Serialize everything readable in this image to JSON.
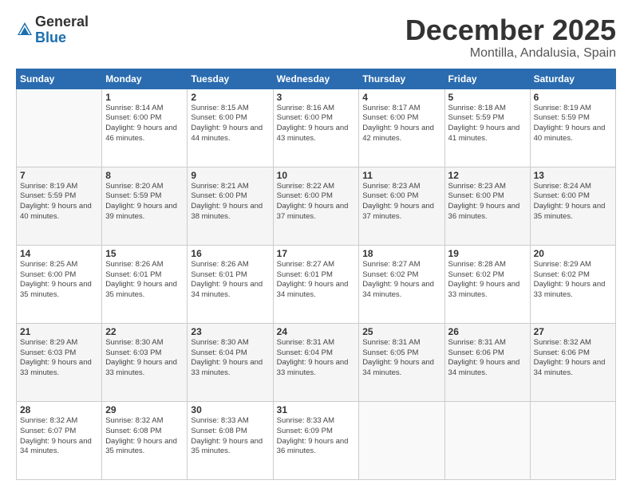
{
  "logo": {
    "general": "General",
    "blue": "Blue"
  },
  "header": {
    "month": "December 2025",
    "location": "Montilla, Andalusia, Spain"
  },
  "weekdays": [
    "Sunday",
    "Monday",
    "Tuesday",
    "Wednesday",
    "Thursday",
    "Friday",
    "Saturday"
  ],
  "weeks": [
    [
      {
        "day": "",
        "sunrise": "",
        "sunset": "",
        "daylight": ""
      },
      {
        "day": "1",
        "sunrise": "Sunrise: 8:14 AM",
        "sunset": "Sunset: 6:00 PM",
        "daylight": "Daylight: 9 hours and 46 minutes."
      },
      {
        "day": "2",
        "sunrise": "Sunrise: 8:15 AM",
        "sunset": "Sunset: 6:00 PM",
        "daylight": "Daylight: 9 hours and 44 minutes."
      },
      {
        "day": "3",
        "sunrise": "Sunrise: 8:16 AM",
        "sunset": "Sunset: 6:00 PM",
        "daylight": "Daylight: 9 hours and 43 minutes."
      },
      {
        "day": "4",
        "sunrise": "Sunrise: 8:17 AM",
        "sunset": "Sunset: 6:00 PM",
        "daylight": "Daylight: 9 hours and 42 minutes."
      },
      {
        "day": "5",
        "sunrise": "Sunrise: 8:18 AM",
        "sunset": "Sunset: 5:59 PM",
        "daylight": "Daylight: 9 hours and 41 minutes."
      },
      {
        "day": "6",
        "sunrise": "Sunrise: 8:19 AM",
        "sunset": "Sunset: 5:59 PM",
        "daylight": "Daylight: 9 hours and 40 minutes."
      }
    ],
    [
      {
        "day": "7",
        "sunrise": "Sunrise: 8:19 AM",
        "sunset": "Sunset: 5:59 PM",
        "daylight": "Daylight: 9 hours and 40 minutes."
      },
      {
        "day": "8",
        "sunrise": "Sunrise: 8:20 AM",
        "sunset": "Sunset: 5:59 PM",
        "daylight": "Daylight: 9 hours and 39 minutes."
      },
      {
        "day": "9",
        "sunrise": "Sunrise: 8:21 AM",
        "sunset": "Sunset: 6:00 PM",
        "daylight": "Daylight: 9 hours and 38 minutes."
      },
      {
        "day": "10",
        "sunrise": "Sunrise: 8:22 AM",
        "sunset": "Sunset: 6:00 PM",
        "daylight": "Daylight: 9 hours and 37 minutes."
      },
      {
        "day": "11",
        "sunrise": "Sunrise: 8:23 AM",
        "sunset": "Sunset: 6:00 PM",
        "daylight": "Daylight: 9 hours and 37 minutes."
      },
      {
        "day": "12",
        "sunrise": "Sunrise: 8:23 AM",
        "sunset": "Sunset: 6:00 PM",
        "daylight": "Daylight: 9 hours and 36 minutes."
      },
      {
        "day": "13",
        "sunrise": "Sunrise: 8:24 AM",
        "sunset": "Sunset: 6:00 PM",
        "daylight": "Daylight: 9 hours and 35 minutes."
      }
    ],
    [
      {
        "day": "14",
        "sunrise": "Sunrise: 8:25 AM",
        "sunset": "Sunset: 6:00 PM",
        "daylight": "Daylight: 9 hours and 35 minutes."
      },
      {
        "day": "15",
        "sunrise": "Sunrise: 8:26 AM",
        "sunset": "Sunset: 6:01 PM",
        "daylight": "Daylight: 9 hours and 35 minutes."
      },
      {
        "day": "16",
        "sunrise": "Sunrise: 8:26 AM",
        "sunset": "Sunset: 6:01 PM",
        "daylight": "Daylight: 9 hours and 34 minutes."
      },
      {
        "day": "17",
        "sunrise": "Sunrise: 8:27 AM",
        "sunset": "Sunset: 6:01 PM",
        "daylight": "Daylight: 9 hours and 34 minutes."
      },
      {
        "day": "18",
        "sunrise": "Sunrise: 8:27 AM",
        "sunset": "Sunset: 6:02 PM",
        "daylight": "Daylight: 9 hours and 34 minutes."
      },
      {
        "day": "19",
        "sunrise": "Sunrise: 8:28 AM",
        "sunset": "Sunset: 6:02 PM",
        "daylight": "Daylight: 9 hours and 33 minutes."
      },
      {
        "day": "20",
        "sunrise": "Sunrise: 8:29 AM",
        "sunset": "Sunset: 6:02 PM",
        "daylight": "Daylight: 9 hours and 33 minutes."
      }
    ],
    [
      {
        "day": "21",
        "sunrise": "Sunrise: 8:29 AM",
        "sunset": "Sunset: 6:03 PM",
        "daylight": "Daylight: 9 hours and 33 minutes."
      },
      {
        "day": "22",
        "sunrise": "Sunrise: 8:30 AM",
        "sunset": "Sunset: 6:03 PM",
        "daylight": "Daylight: 9 hours and 33 minutes."
      },
      {
        "day": "23",
        "sunrise": "Sunrise: 8:30 AM",
        "sunset": "Sunset: 6:04 PM",
        "daylight": "Daylight: 9 hours and 33 minutes."
      },
      {
        "day": "24",
        "sunrise": "Sunrise: 8:31 AM",
        "sunset": "Sunset: 6:04 PM",
        "daylight": "Daylight: 9 hours and 33 minutes."
      },
      {
        "day": "25",
        "sunrise": "Sunrise: 8:31 AM",
        "sunset": "Sunset: 6:05 PM",
        "daylight": "Daylight: 9 hours and 34 minutes."
      },
      {
        "day": "26",
        "sunrise": "Sunrise: 8:31 AM",
        "sunset": "Sunset: 6:06 PM",
        "daylight": "Daylight: 9 hours and 34 minutes."
      },
      {
        "day": "27",
        "sunrise": "Sunrise: 8:32 AM",
        "sunset": "Sunset: 6:06 PM",
        "daylight": "Daylight: 9 hours and 34 minutes."
      }
    ],
    [
      {
        "day": "28",
        "sunrise": "Sunrise: 8:32 AM",
        "sunset": "Sunset: 6:07 PM",
        "daylight": "Daylight: 9 hours and 34 minutes."
      },
      {
        "day": "29",
        "sunrise": "Sunrise: 8:32 AM",
        "sunset": "Sunset: 6:08 PM",
        "daylight": "Daylight: 9 hours and 35 minutes."
      },
      {
        "day": "30",
        "sunrise": "Sunrise: 8:33 AM",
        "sunset": "Sunset: 6:08 PM",
        "daylight": "Daylight: 9 hours and 35 minutes."
      },
      {
        "day": "31",
        "sunrise": "Sunrise: 8:33 AM",
        "sunset": "Sunset: 6:09 PM",
        "daylight": "Daylight: 9 hours and 36 minutes."
      },
      {
        "day": "",
        "sunrise": "",
        "sunset": "",
        "daylight": ""
      },
      {
        "day": "",
        "sunrise": "",
        "sunset": "",
        "daylight": ""
      },
      {
        "day": "",
        "sunrise": "",
        "sunset": "",
        "daylight": ""
      }
    ]
  ]
}
